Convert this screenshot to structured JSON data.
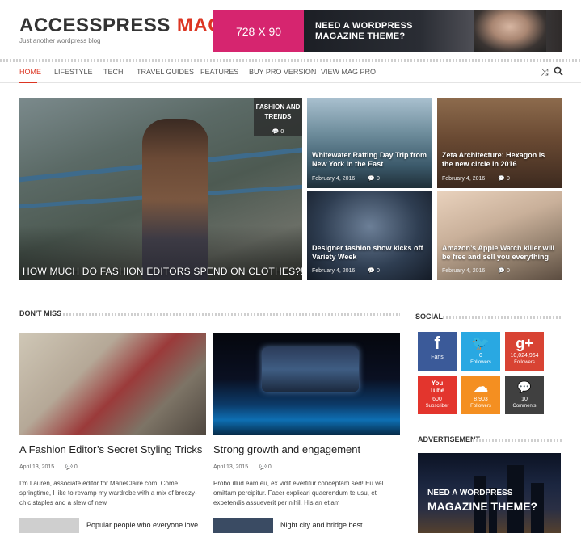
{
  "site": {
    "logo_part1": "ACCESSPRESS",
    "logo_part2": "MAG",
    "tagline": "Just another wordpress blog",
    "ad": {
      "size_label": "728 X 90",
      "line1": "NEED A WORDPRESS",
      "line2": "MAGAZINE THEME?"
    }
  },
  "nav": {
    "items": [
      {
        "label": "HOME",
        "active": true
      },
      {
        "label": "LIFESTYLE"
      },
      {
        "label": "TECH"
      },
      {
        "label": "TRAVEL GUIDES"
      },
      {
        "label": "FEATURES"
      },
      {
        "label": "BUY PRO VERSION"
      },
      {
        "label": "VIEW MAG PRO"
      }
    ],
    "icons": [
      "shuffle-icon",
      "search-icon"
    ]
  },
  "featured": {
    "big": {
      "category_line1": "FASHION AND",
      "category_line2": "TRENDS",
      "comments": "0",
      "title": "HOW MUCH DO FASHION EDITORS SPEND ON CLOTHES?!"
    },
    "tiles": [
      {
        "title": "Whitewater Rafting Day Trip from New York in the East",
        "date": "February 4, 2016",
        "comments": "0"
      },
      {
        "title": "Zeta Architecture: Hexagon is the new circle in 2016",
        "date": "February 4, 2016",
        "comments": "0"
      },
      {
        "title": "Designer fashion show kicks off Variety Week",
        "date": "February 4, 2016",
        "comments": "0"
      },
      {
        "title": "Amazon’s Apple Watch killer will be free and sell you everything",
        "date": "February 4, 2016",
        "comments": "0"
      }
    ]
  },
  "dont_miss": {
    "heading": "DON'T MISS",
    "cards": [
      {
        "title": "A Fashion Editor’s Secret Styling Tricks",
        "date": "April 13, 2015",
        "comments": "0",
        "excerpt": "I’m Lauren, associate editor for MarieClaire.com. Come springtime, I like to revamp my wardrobe with a mix of breezy-chic staples and a slew of new"
      },
      {
        "title": "Strong growth and engagement",
        "date": "April 13, 2015",
        "comments": "0",
        "excerpt": "Probo illud eam eu, ex vidit evertitur conceptam sed! Eu vel omittam percipitur. Facer explicari quaerendum te usu, et expetendis assueverit per nihil. His an etiam"
      }
    ],
    "mini": [
      {
        "title": "Popular people who everyone love"
      },
      {
        "title": "Night city and bridge best"
      }
    ]
  },
  "social": {
    "heading": "SOCIAL",
    "items": [
      {
        "icon": "facebook-icon",
        "glyph": "f",
        "count": "",
        "label": "Fans",
        "color": "#3b5a99"
      },
      {
        "icon": "twitter-icon",
        "glyph": "t",
        "count": "0",
        "label": "Followers",
        "color": "#29a8e2"
      },
      {
        "icon": "googleplus-icon",
        "glyph": "g+",
        "count": "10,024,964",
        "label": "Followers",
        "color": "#d84333"
      },
      {
        "icon": "youtube-icon",
        "glyph": "You Tube",
        "count": "600",
        "label": "Subscriber",
        "color": "#e3352d"
      },
      {
        "icon": "soundcloud-icon",
        "glyph": "☁",
        "count": "8,903",
        "label": "Followers",
        "color": "#f48f21"
      },
      {
        "icon": "comments-icon",
        "glyph": "💬",
        "count": "10",
        "label": "Comments",
        "color": "#404040"
      }
    ]
  },
  "advertisement": {
    "heading": "ADVERTISEMENT",
    "line1": "NEED A WORDPRESS",
    "line2": "MAGAZINE THEME?"
  },
  "colors": {
    "accent": "#dc3522",
    "ad_pink": "#d6256f"
  }
}
